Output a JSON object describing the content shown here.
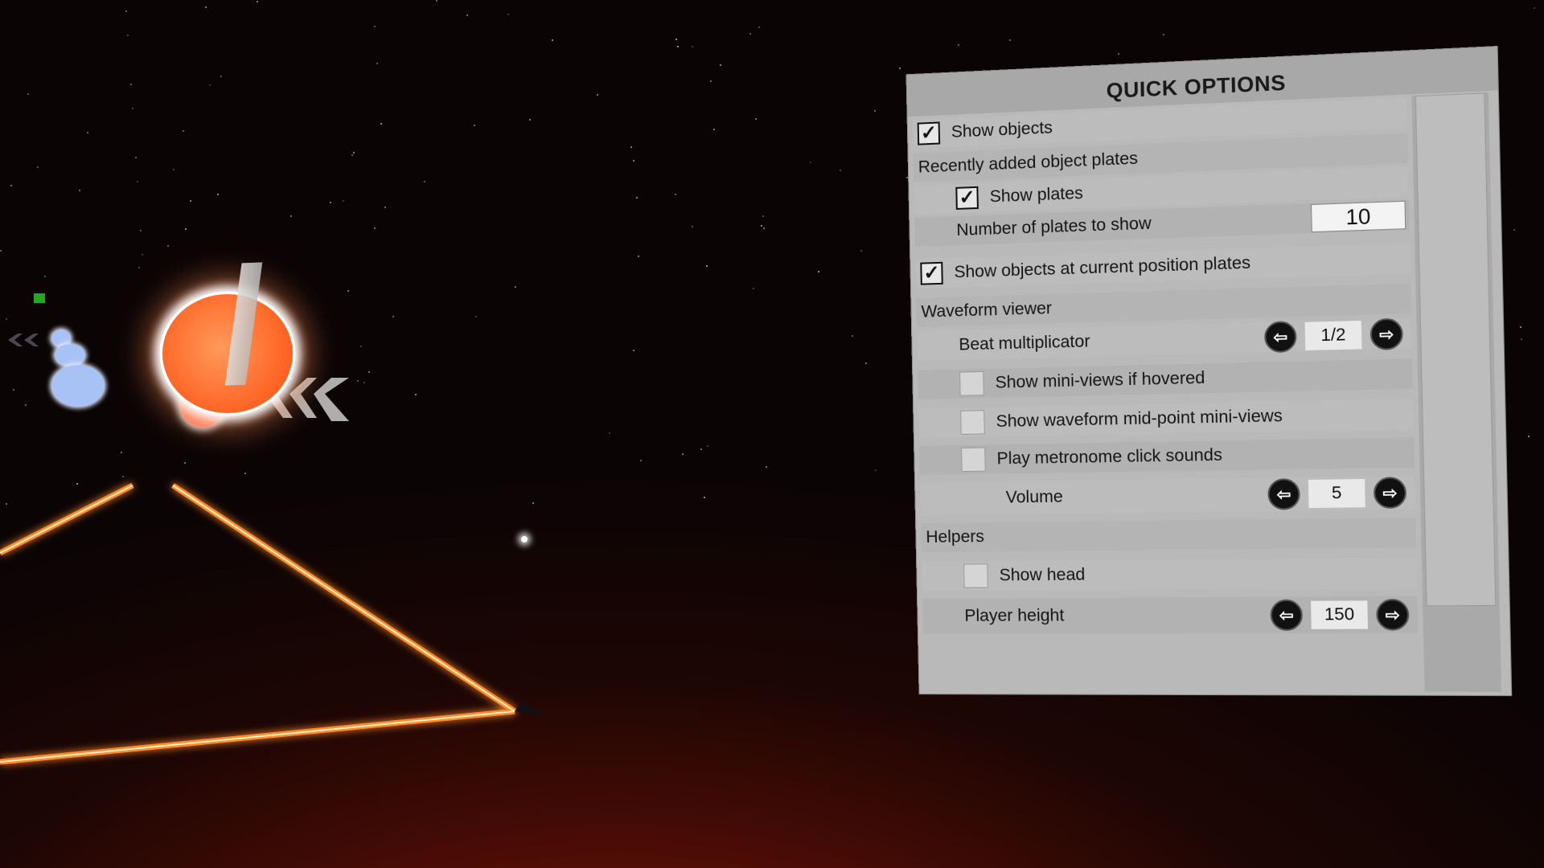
{
  "panel": {
    "title": "QUICK OPTIONS",
    "show_objects": {
      "label": "Show objects",
      "checked": true
    },
    "recent_plates": {
      "header": "Recently added object plates",
      "show_plates": {
        "label": "Show plates",
        "checked": true
      },
      "number_of_plates": {
        "label": "Number of plates to show",
        "value": "10"
      }
    },
    "show_current_position_plates": {
      "label": "Show objects at current position plates",
      "checked": true
    },
    "waveform": {
      "header": "Waveform viewer",
      "beat_multiplicator": {
        "label": "Beat multiplicator",
        "value": "1/2"
      },
      "show_mini_views": {
        "label": "Show mini-views if hovered",
        "checked": false
      },
      "show_midpoint_mini_views": {
        "label": "Show waveform mid-point mini-views",
        "checked": false
      },
      "play_metronome": {
        "label": "Play metronome click sounds",
        "checked": false
      },
      "volume": {
        "label": "Volume",
        "value": "5"
      }
    },
    "helpers": {
      "header": "Helpers",
      "show_head": {
        "label": "Show head",
        "checked": false
      },
      "player_height": {
        "label": "Player height",
        "value": "150"
      }
    },
    "icons": {
      "check": "✓",
      "left_arrow": "⇦",
      "right_arrow": "⇨"
    }
  },
  "colors": {
    "orb": "#ff6a2a",
    "track_glow": "#ff7a1a",
    "blue_orb": "#a9c2f5"
  }
}
